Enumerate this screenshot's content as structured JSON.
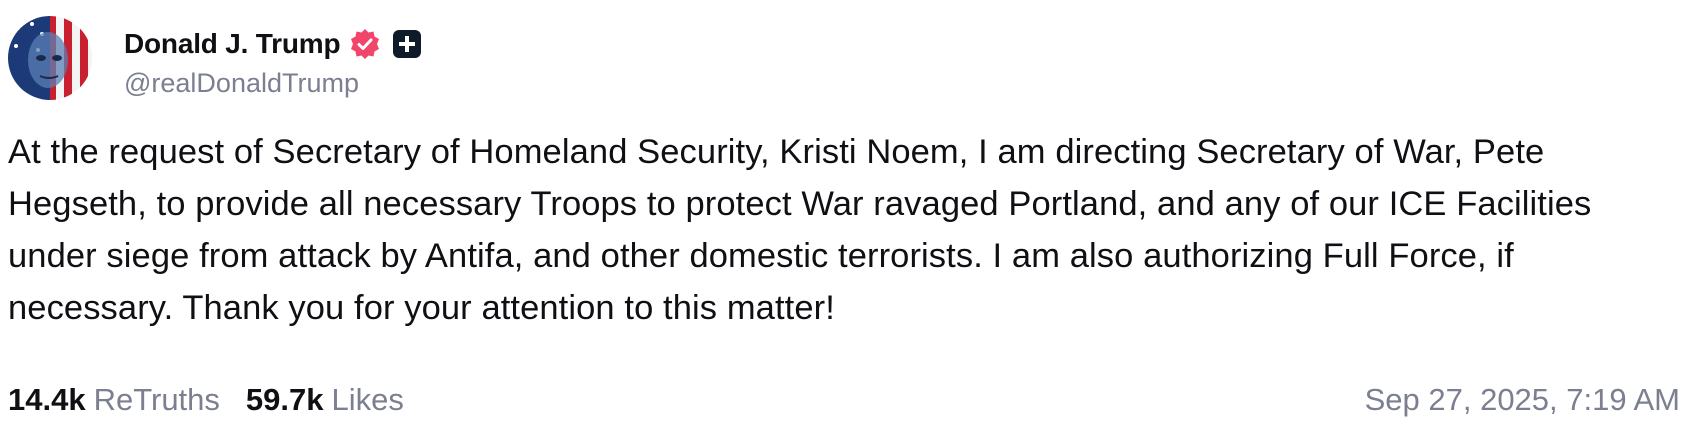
{
  "author": {
    "display_name": "Donald J. Trump",
    "handle": "@realDonaldTrump",
    "verified_icon": "verified-badge-icon",
    "plus_icon": "plus-badge-icon",
    "verified_color": "#f2456a"
  },
  "post": {
    "text": "At the request of Secretary of Homeland Security, Kristi Noem, I am directing Secretary of War, Pete Hegseth, to provide all necessary Troops to protect War ravaged Portland, and any of our ICE Facilities under siege from attack by Antifa, and other domestic terrorists. I am also authorizing Full Force, if necessary. Thank you for your attention to this matter!"
  },
  "stats": {
    "retruths_count": "14.4k",
    "retruths_label": "ReTruths",
    "likes_count": "59.7k",
    "likes_label": "Likes"
  },
  "timestamp": "Sep 27, 2025, 7:19 AM"
}
